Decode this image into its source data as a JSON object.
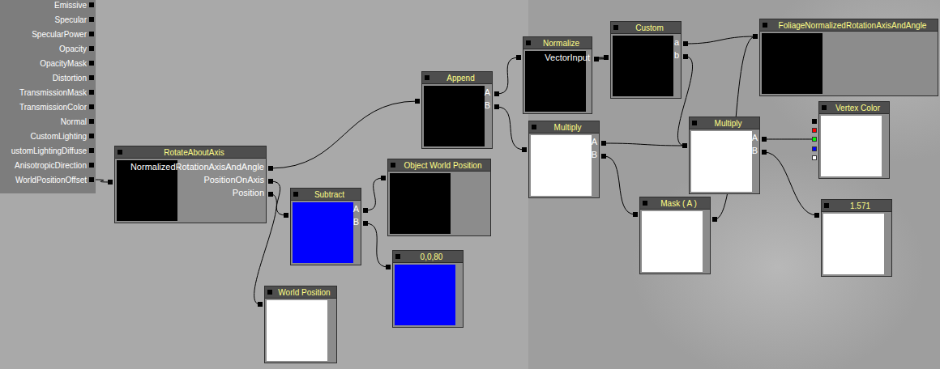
{
  "material": {
    "pins": [
      {
        "label": "Emissive"
      },
      {
        "label": "Specular"
      },
      {
        "label": "SpecularPower"
      },
      {
        "label": "Opacity"
      },
      {
        "label": "OpacityMask"
      },
      {
        "label": "Distortion"
      },
      {
        "label": "TransmissionMask"
      },
      {
        "label": "TransmissionColor"
      },
      {
        "label": "Normal"
      },
      {
        "label": "CustomLighting"
      },
      {
        "label": "ustomLightingDiffuse"
      },
      {
        "label": "AnisotropicDirection"
      },
      {
        "label": "WorldPositionOffset"
      }
    ]
  },
  "nodes": [
    {
      "title": "RotateAboutAxis",
      "color": "#000000",
      "inputs": [
        {
          "label": "NormalizedRotationAxisAndAngle"
        },
        {
          "label": "PositionOnAxis"
        },
        {
          "label": "Position"
        }
      ],
      "outputs": [
        {
          "color": "#000000"
        }
      ]
    },
    {
      "title": "Subtract",
      "color": "#0000ff",
      "inputs": [
        {
          "label": "A"
        },
        {
          "label": "B"
        }
      ],
      "outputs": [
        {
          "color": "#000000"
        }
      ]
    },
    {
      "title": "Object World Position",
      "color": "#000000",
      "inputs": [],
      "outputs": [
        {
          "color": "#000000"
        }
      ]
    },
    {
      "title": "0,0,80",
      "color": "#0000ff",
      "inputs": [],
      "outputs": [
        {
          "color": "#000000"
        }
      ]
    },
    {
      "title": "World Position",
      "color": "#ffffff",
      "inputs": [],
      "outputs": [
        {
          "color": "#000000"
        }
      ]
    },
    {
      "title": "Append",
      "color": "#000000",
      "inputs": [
        {
          "label": "A"
        },
        {
          "label": "B"
        }
      ],
      "outputs": [
        {
          "color": "#000000"
        }
      ]
    },
    {
      "title": "Normalize",
      "color": "#000000",
      "inputs": [
        {
          "label": "VectorInput"
        }
      ],
      "outputs": [
        {
          "color": "#000000"
        }
      ]
    },
    {
      "title": "Custom",
      "color": "#000000",
      "inputs": [
        {
          "label": "a"
        },
        {
          "label": "b"
        }
      ],
      "outputs": [
        {
          "color": "#000000"
        }
      ]
    },
    {
      "title": "FoliageNormalizedRotationAxisAndAngle",
      "color": "#000000",
      "inputs": [],
      "outputs": [
        {
          "color": "#000000"
        }
      ]
    },
    {
      "title": "Multiply",
      "color": "#ffffff",
      "inputs": [
        {
          "label": "A"
        },
        {
          "label": "B"
        }
      ],
      "outputs": [
        {
          "color": "#000000"
        }
      ]
    },
    {
      "title": "Multiply",
      "color": "#ffffff",
      "inputs": [
        {
          "label": "A"
        },
        {
          "label": "B"
        }
      ],
      "outputs": [
        {
          "color": "#000000"
        }
      ]
    },
    {
      "title": "Vertex Color",
      "color": "#ffffff",
      "inputs": [],
      "outputs": [
        {
          "color": "#000000"
        },
        {
          "color": "#ff0000"
        },
        {
          "color": "#00ff00"
        },
        {
          "color": "#0000ff"
        },
        {
          "color": "#ffffff"
        }
      ]
    },
    {
      "title": "Mask ( A )",
      "color": "#ffffff",
      "inputs": [
        {
          "label": ""
        }
      ],
      "outputs": [
        {
          "color": "#000000"
        }
      ]
    },
    {
      "title": "1.571",
      "color": "#ffffff",
      "inputs": [],
      "outputs": [
        {
          "color": "#000000"
        }
      ]
    }
  ],
  "links": [
    {
      "from": 0,
      "out": 0,
      "to": "material",
      "pin": 12
    },
    {
      "from": 5,
      "out": 0,
      "to": 0,
      "pin": 0
    },
    {
      "from": 1,
      "out": 0,
      "to": 0,
      "pin": 1
    },
    {
      "from": 4,
      "out": 0,
      "to": 0,
      "pin": 2
    },
    {
      "from": 2,
      "out": 0,
      "to": 1,
      "pin": 0
    },
    {
      "from": 3,
      "out": 0,
      "to": 1,
      "pin": 1
    },
    {
      "from": 6,
      "out": 0,
      "to": 5,
      "pin": 0
    },
    {
      "from": 9,
      "out": 0,
      "to": 5,
      "pin": 1
    },
    {
      "from": 7,
      "out": 0,
      "to": 6,
      "pin": 0
    },
    {
      "from": 8,
      "out": 0,
      "to": 7,
      "pin": 0
    },
    {
      "from": 10,
      "out": 0,
      "to": 7,
      "pin": 1
    },
    {
      "from": 10,
      "out": 0,
      "to": 9,
      "pin": 0
    },
    {
      "from": 12,
      "out": 0,
      "to": 9,
      "pin": 1
    },
    {
      "from": 8,
      "out": 0,
      "to": 12,
      "pin": 0
    },
    {
      "from": 11,
      "out": 2,
      "to": 10,
      "pin": 0
    },
    {
      "from": 13,
      "out": 0,
      "to": 10,
      "pin": 1
    }
  ]
}
